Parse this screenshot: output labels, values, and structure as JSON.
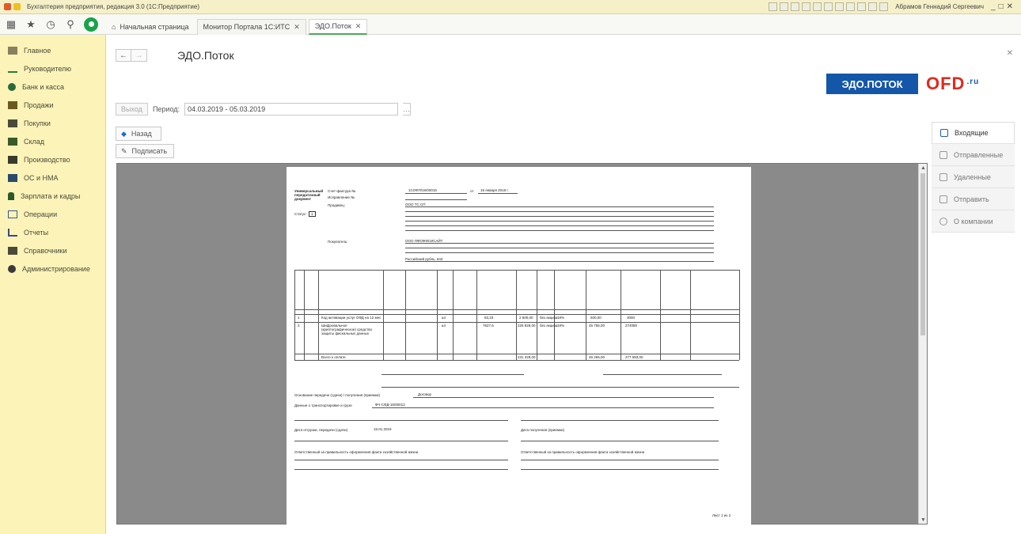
{
  "window": {
    "title": "Бухгалтерия предприятия, редакция 3.0  (1С:Предприятие)",
    "user": "Абрамов Геннадий Сергеевич"
  },
  "tabs": [
    {
      "label": "Начальная страница"
    },
    {
      "label": "Монитор Портала 1С:ИТС"
    },
    {
      "label": "ЭДО.Поток"
    }
  ],
  "sidebar": {
    "items": [
      {
        "label": "Главное",
        "icon": "menu-icon"
      },
      {
        "label": "Руководителю",
        "icon": "chart-icon"
      },
      {
        "label": "Банк и касса",
        "icon": "coin-icon"
      },
      {
        "label": "Продажи",
        "icon": "bag-icon"
      },
      {
        "label": "Покупки",
        "icon": "cart-icon"
      },
      {
        "label": "Склад",
        "icon": "warehouse-icon"
      },
      {
        "label": "Производство",
        "icon": "factory-icon"
      },
      {
        "label": "ОС и НМА",
        "icon": "truck-icon"
      },
      {
        "label": "Зарплата и кадры",
        "icon": "person-icon"
      },
      {
        "label": "Операции",
        "icon": "operations-icon"
      },
      {
        "label": "Отчеты",
        "icon": "report-icon"
      },
      {
        "label": "Справочники",
        "icon": "book-icon"
      },
      {
        "label": "Администрирование",
        "icon": "gear-icon"
      }
    ]
  },
  "page": {
    "title": "ЭДО.Поток",
    "banner_left": "ЭДО.ПОТОК",
    "banner_right": "OFD",
    "banner_suffix": ".ru"
  },
  "filters": {
    "exit_label": "Выход",
    "period_label": "Период:",
    "period_value": "04.03.2019 - 05.03.2019"
  },
  "actions": {
    "back_label": "Назад",
    "sign_label": "Подписать"
  },
  "right_panel": [
    {
      "label": "Входящие",
      "active": true,
      "icon": "inbox-icon"
    },
    {
      "label": "Отправленные",
      "active": false,
      "icon": "outbox-icon"
    },
    {
      "label": "Удаленные",
      "active": false,
      "icon": "trash-icon"
    },
    {
      "label": "Отправить",
      "active": false,
      "icon": "send-icon"
    },
    {
      "label": "О компании",
      "active": false,
      "icon": "info-icon"
    }
  ],
  "document": {
    "doc_type": "Универсальный передаточный документ",
    "invoice_label": "Счет-фактура №",
    "invoice_number": "1СОФП/19/00015",
    "invoice_date": "15 января 2019 г.",
    "correction_label": "Исправление №",
    "status_label": "Статус:",
    "status_value": "1",
    "seller_label": "Продавец:",
    "seller_name": "ООО ТС СП",
    "buyer_label": "Покупатель:",
    "buyer_name": "ООО ПФОФФСИСАЙТ",
    "currency": "Российский рубль, 643",
    "rows": [
      {
        "n": "1",
        "name": "Код активации услуг ОФД на 12 мес",
        "unit": "шт",
        "price": "83,33",
        "sum": "2 500,00",
        "tax": "без акциза",
        "rate": "18%",
        "vat": "500,00",
        "total": "3000"
      },
      {
        "n": "2",
        "name": "Шифровальное (криптографическое) средство защиты фискальных данных",
        "unit": "шт",
        "price": "7627,6",
        "sum": "225 828,00",
        "tax": "без акциза",
        "rate": "18%",
        "vat": "45 765,00",
        "total": "274080"
      }
    ],
    "total_label": "Всего к оплате",
    "total_sum": "231 328,00",
    "total_vat": "46 265,00",
    "total_all": "277 593,00",
    "basis_label": "Основание передачи (сдачи) / получения (приемки)",
    "basis_value": "Договор",
    "transport_label": "Данные о транспортировке и грузе",
    "transport_value": "ФЧ-СФД-15/00013",
    "shipment_date_label": "Дата отгрузки, передачи (сдачи)",
    "shipment_date": "15.01.2019",
    "receipt_label": "Дата получения (приемки)",
    "responsible_label": "Ответственный за правильность оформления факта хозяйственной жизни",
    "page_label": "Лист 1 из 2"
  },
  "colors": {
    "sidebar_bg": "#fcf3b8",
    "titlebar_bg": "#f6f0c8",
    "banner_blue": "#1456a8",
    "banner_red": "#e02a1c",
    "home_green": "#17a34a",
    "viewer_bg": "#8a8a8a"
  }
}
